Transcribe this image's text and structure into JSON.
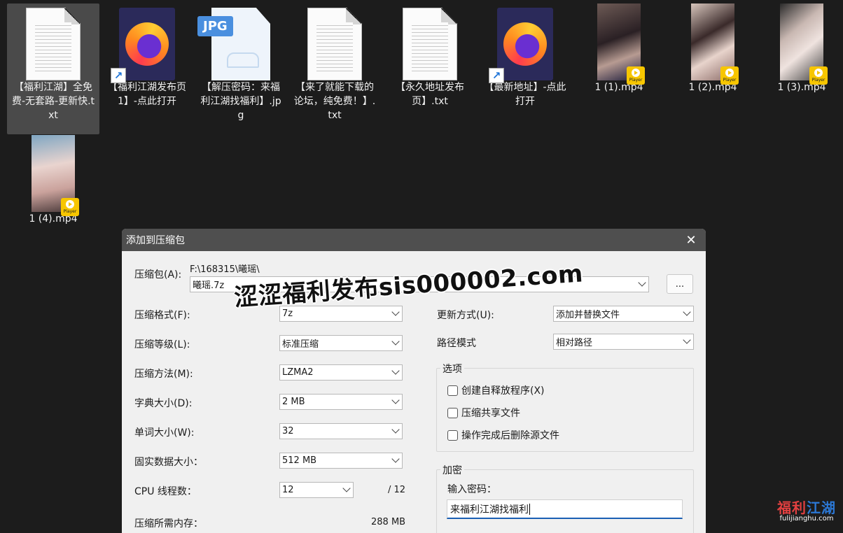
{
  "desktop": {
    "files": [
      {
        "name": "【福利江湖】全免费-无套路-更新快.txt",
        "type": "txt",
        "selected": true,
        "shortcut": false
      },
      {
        "name": "【福利江湖发布页1】-点此打开",
        "type": "firefox-shortcut",
        "selected": false,
        "shortcut": true
      },
      {
        "name": "【解压密码：来福利江湖找福利】.jpg",
        "type": "jpg",
        "selected": false,
        "shortcut": false
      },
      {
        "name": "【来了就能下载的论坛，纯免费！】.txt",
        "type": "txt",
        "selected": false,
        "shortcut": false
      },
      {
        "name": "【永久地址发布页】.txt",
        "type": "txt",
        "selected": false,
        "shortcut": false
      },
      {
        "name": "【最新地址】-点此打开",
        "type": "firefox-shortcut",
        "selected": false,
        "shortcut": true
      },
      {
        "name": "1 (1).mp4",
        "type": "mp4",
        "selected": false,
        "shortcut": false
      },
      {
        "name": "1 (2).mp4",
        "type": "mp4",
        "selected": false,
        "shortcut": false
      },
      {
        "name": "1 (3).mp4",
        "type": "mp4",
        "selected": false,
        "shortcut": false
      },
      {
        "name": "1 (4).mp4",
        "type": "mp4",
        "selected": false,
        "shortcut": false
      }
    ],
    "jpg_badge": "JPG",
    "player_badge": "Player",
    "shortcut_arrow": "↗"
  },
  "dialog": {
    "title": "添加到压缩包",
    "close_glyph": "✕",
    "archive_label": "压缩包(A):",
    "archive_path": "F:\\168315\\曦瑶\\",
    "archive_name": "曦瑶.7z",
    "browse_label": "...",
    "format_label": "压缩格式(F):",
    "format_value": "7z",
    "level_label": "压缩等级(L):",
    "level_value": "标准压缩",
    "method_label": "压缩方法(M):",
    "method_value": "LZMA2",
    "dict_label": "字典大小(D):",
    "dict_value": "2 MB",
    "word_label": "单词大小(W):",
    "word_value": "32",
    "solid_label": "固实数据大小：",
    "solid_value": "512 MB",
    "cpu_label": "CPU 线程数：",
    "cpu_value": "12",
    "cpu_total": "/ 12",
    "mem_label": "压缩所需内存：",
    "mem_value": "288 MB",
    "update_label": "更新方式(U):",
    "update_value": "添加并替换文件",
    "path_label": "路径模式",
    "path_value": "相对路径",
    "options_title": "选项",
    "options": [
      {
        "label": "创建自释放程序(X)",
        "checked": false
      },
      {
        "label": "压缩共享文件",
        "checked": false
      },
      {
        "label": "操作完成后删除源文件",
        "checked": false
      }
    ],
    "encrypt_title": "加密",
    "password_label": "输入密码：",
    "password_value": "来福利江湖找福利"
  },
  "watermarks": {
    "main": "涩涩福利发布sis000002.com",
    "logo_a": "福利",
    "logo_b": "江湖",
    "logo_sub": "fulijianghu.com"
  },
  "colors": {
    "desktop_bg": "#1c1c1c",
    "selection": "#4a4a4a",
    "dialog_bg": "#f0f0f0",
    "titlebar": "#4f4f4f",
    "accent": "#1a5fb4",
    "player_badge": "#f7c600",
    "jpg_badge": "#4a8fdf",
    "logo_red": "#e24040",
    "logo_blue": "#2b78d6"
  }
}
